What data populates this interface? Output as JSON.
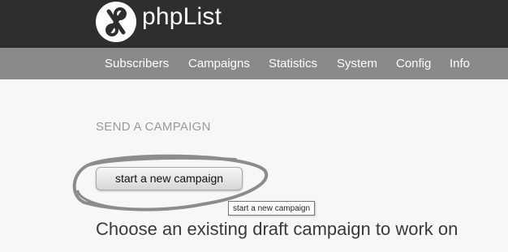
{
  "header": {
    "logo_text": "phpList",
    "logo_icon": "phplist-infinity-logo-icon"
  },
  "nav": {
    "items": [
      {
        "label": "Subscribers"
      },
      {
        "label": "Campaigns"
      },
      {
        "label": "Statistics"
      },
      {
        "label": "System"
      },
      {
        "label": "Config"
      },
      {
        "label": "Info"
      }
    ]
  },
  "main": {
    "title": "SEND A CAMPAIGN",
    "start_button_label": "start a new campaign",
    "tooltip_text": "start a new campaign",
    "draft_heading": "Choose an existing draft campaign to work on"
  },
  "colors": {
    "header_bg": "#2e2e2e",
    "nav_bg": "#8a8a8a",
    "page_bg": "#f7f7f7",
    "annotation_stroke": "#8c8c8c"
  }
}
